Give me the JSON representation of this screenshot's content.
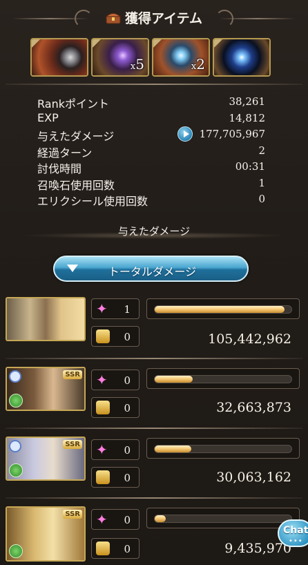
{
  "header": {
    "title": "獲得アイテム",
    "icon": "treasure-chest-icon"
  },
  "items": [
    {
      "name": "item-1",
      "quantity": ""
    },
    {
      "name": "item-2",
      "quantity": "5"
    },
    {
      "name": "item-3",
      "quantity": "2"
    },
    {
      "name": "item-4",
      "quantity": ""
    }
  ],
  "stats": [
    {
      "label": "Rankポイント",
      "value": "38,261"
    },
    {
      "label": "EXP",
      "value": "14,812"
    },
    {
      "label": "与えたダメージ",
      "value": "177,705,967"
    },
    {
      "label": "経過ターン",
      "value": "2"
    },
    {
      "label": "討伐時間",
      "value": "00:31"
    },
    {
      "label": "召喚石使用回数",
      "value": "1"
    },
    {
      "label": "エリクシール使用回数",
      "value": "0"
    }
  ],
  "damage_section": {
    "title": "与えたダメージ",
    "total_button": "トータルダメージ"
  },
  "characters": [
    {
      "portrait": "character-pair",
      "ssr": "",
      "special_count": "1",
      "break_count": "0",
      "damage": "105,442,962",
      "damage_share": 0.95
    },
    {
      "portrait": "character-ssr-1",
      "ssr": "SSR",
      "special_count": "0",
      "break_count": "0",
      "damage": "32,663,873",
      "damage_share": 0.28
    },
    {
      "portrait": "character-ssr-2",
      "ssr": "SSR",
      "special_count": "0",
      "break_count": "0",
      "damage": "30,063,162",
      "damage_share": 0.27
    },
    {
      "portrait": "character-ssr-3",
      "ssr": "SSR",
      "special_count": "0",
      "break_count": "0",
      "damage": "9,435,970",
      "damage_share": 0.08
    }
  ],
  "chat": {
    "label": "Chat",
    "dots": "•••"
  },
  "colors": {
    "accent": "#2b84b5",
    "gold": "#f3c572",
    "background": "#221d19"
  }
}
